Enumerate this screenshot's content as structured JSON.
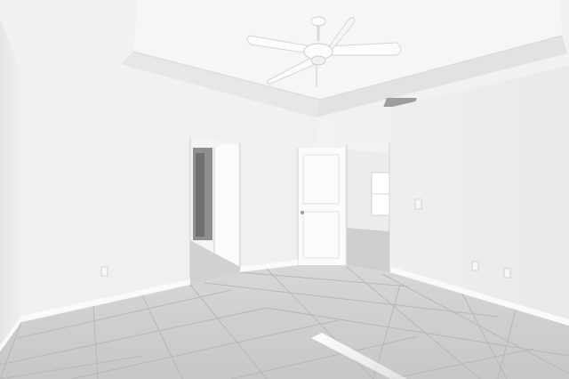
{
  "scene": {
    "subject": "empty-room-interior",
    "colors": {
      "ceiling": "#f1f1f1",
      "tray_ceiling": "#f6f6f6",
      "left_wall": "#ececec",
      "back_wall": "#f0f0f0",
      "right_wall": "#ededed",
      "floor": "#c9cacb",
      "grout": "#b5b6b7",
      "baseboard": "#fafafa",
      "door": "#fbfbfb",
      "doorway_dark": "#8e8f90",
      "window_light": "#ffffff",
      "fan_body": "#fcfcfc"
    }
  }
}
